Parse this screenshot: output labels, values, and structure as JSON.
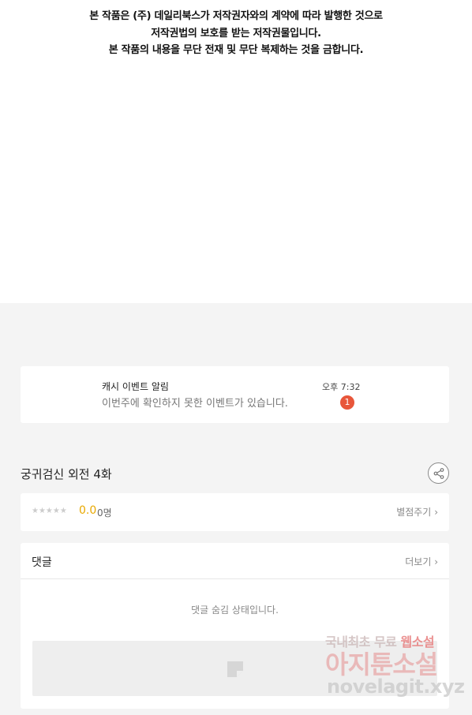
{
  "copyright": {
    "line1": "본 작품은 (주) 데일리북스가 저작권자와의 계약에 따라 발행한 것으로",
    "line2": "저작권법의 보호를 받는 저작권물입니다.",
    "line3": "본 작품의 내용을 무단 전재 및 무단 복제하는 것을 금합니다."
  },
  "event": {
    "title": "캐시 이벤트 알림",
    "description": "이번주에 확인하지 못한 이벤트가 있습니다.",
    "time": "오후 7:32",
    "badge_count": "1",
    "badge_color": "#e8563a"
  },
  "episode": {
    "title": "궁귀검신 외전 4화",
    "share_icon": "share-icon"
  },
  "rating": {
    "stars": "★★★★★",
    "score": "0.0",
    "people": "0명",
    "rate_link": "별점주기",
    "score_color": "#e8a800"
  },
  "comments": {
    "label": "댓글",
    "more_link": "더보기",
    "hidden_message": "댓글 숨김 상태입니다."
  },
  "watermark": {
    "line1_part1": "국내최초 무료",
    "line1_part2": "웹소설",
    "line2": "아지툰소설",
    "line3": "novelagit.xyz"
  }
}
